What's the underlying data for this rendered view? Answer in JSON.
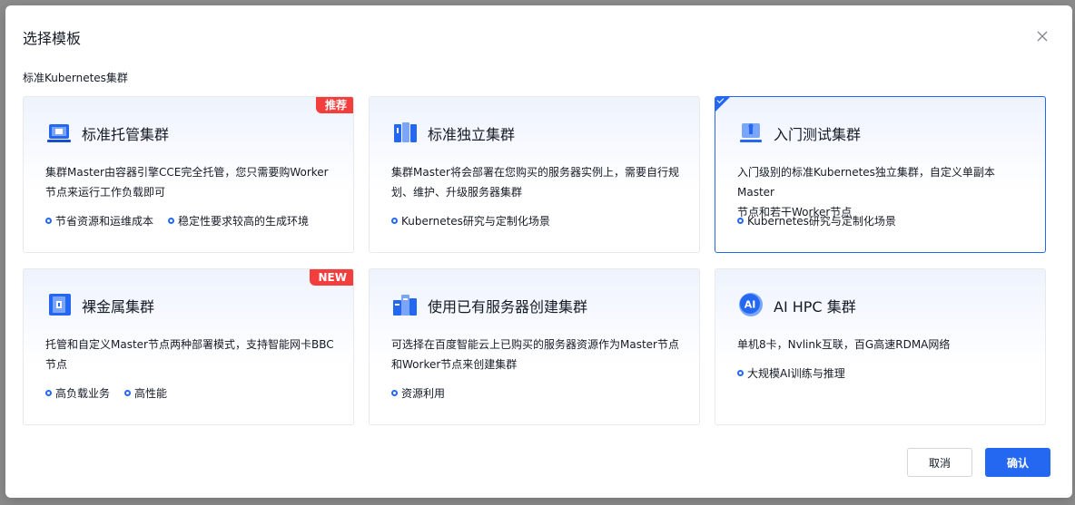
{
  "dialog": {
    "title": "选择模板",
    "section_label": "标准Kubernetes集群",
    "cancel_label": "取消",
    "confirm_label": "确认"
  },
  "cards": [
    {
      "title": "标准托管集群",
      "desc_line1": "集群Master由容器引擎CCE完全托管，您只需要购Worker",
      "desc_line2": "节点来运行工作负载即可",
      "features": [
        "节省资源和运维成本",
        "稳定性要求较高的生成环境"
      ],
      "badge": "推荐",
      "icon": "managed-cluster-icon",
      "selected": false
    },
    {
      "title": "标准独立集群",
      "desc_line1": "集群Master将会部署在您购买的服务器实例上，需要自行规",
      "desc_line2": "划、维护、升级服务器集群",
      "features": [
        "Kubernetes研究与定制化场景"
      ],
      "badge": "",
      "icon": "independent-cluster-icon",
      "selected": false
    },
    {
      "title": "入门测试集群",
      "desc_line1": "入门级别的标准Kubernetes独立集群，自定义单副本Master",
      "desc_line2": "节点和若干Worker节点",
      "features": [
        "Kubernetes研究与定制化场景"
      ],
      "badge": "",
      "icon": "test-cluster-icon",
      "selected": true
    },
    {
      "title": "裸金属集群",
      "desc_line1": "托管和自定义Master节点两种部署模式，支持智能网卡BBC",
      "desc_line2": "节点",
      "features": [
        "高负载业务",
        "高性能"
      ],
      "badge": "NEW",
      "icon": "bare-metal-cluster-icon",
      "selected": false
    },
    {
      "title": "使用已有服务器创建集群",
      "desc_line1": "可选择在百度智能云上已购买的服务器资源作为Master节点",
      "desc_line2": "和Worker节点来创建集群",
      "features": [
        "资源利用"
      ],
      "badge": "",
      "icon": "existing-server-cluster-icon",
      "selected": false
    },
    {
      "title": "AI HPC 集群",
      "desc_line1": "单机8卡，Nvlink互联，百G高速RDMA网络",
      "desc_line2": "",
      "features": [
        "大规模AI训练与推理"
      ],
      "badge": "",
      "icon": "ai-hpc-cluster-icon",
      "icon_text": "AI",
      "selected": false
    }
  ],
  "colors": {
    "primary": "#2468f2",
    "badge_red": "#f33e3e"
  }
}
